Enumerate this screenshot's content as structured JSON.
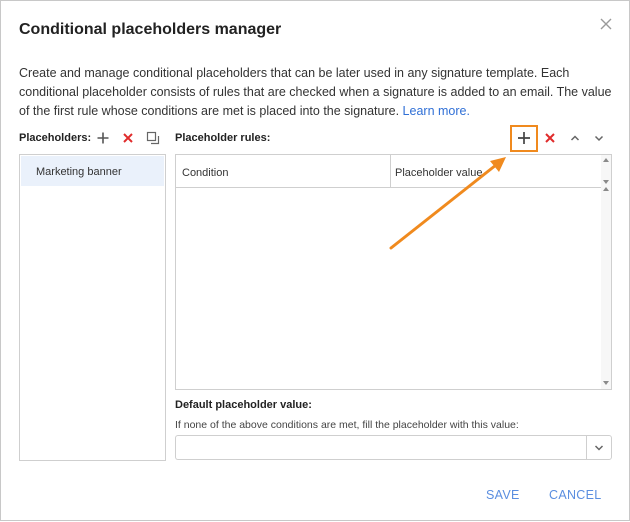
{
  "dialog": {
    "title": "Conditional placeholders manager",
    "close_icon": "close-icon",
    "description": "Create and manage conditional placeholders that can be later used in any signature template. Each conditional placeholder consists of rules that are checked when a signature is added to an email. The value of the first rule whose conditions are met is placed into the signature. ",
    "learn_more": "Learn more."
  },
  "placeholders": {
    "label": "Placeholders:",
    "icons": [
      "plus-icon",
      "delete-icon",
      "duplicate-icon"
    ],
    "items": [
      {
        "label": "Marketing banner",
        "selected": true
      }
    ]
  },
  "rules": {
    "label": "Placeholder rules:",
    "icons": [
      "plus-icon",
      "delete-icon",
      "chevron-up-icon",
      "chevron-down-icon"
    ],
    "columns": [
      "Condition",
      "Placeholder value"
    ],
    "rows": []
  },
  "default_value": {
    "label": "Default placeholder value:",
    "note": "If none of the above conditions are met, fill the placeholder with this value:",
    "value": ""
  },
  "footer": {
    "save": "SAVE",
    "cancel": "CANCEL"
  },
  "colors": {
    "accent": "#5a8ee0",
    "delete": "#e02b2b",
    "highlight": "#f08a1e",
    "selected_bg": "#eaf1fb"
  }
}
